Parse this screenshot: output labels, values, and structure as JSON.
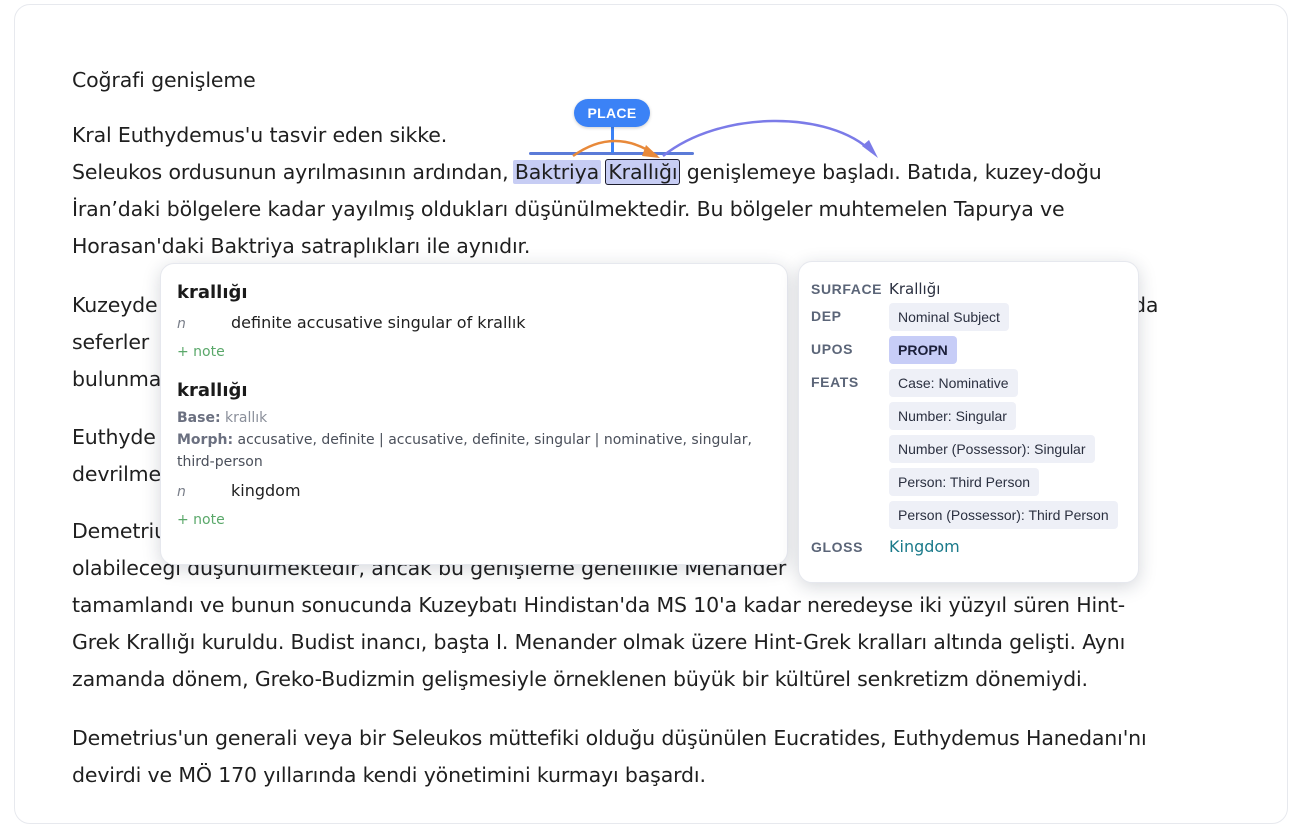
{
  "heading": "Coğrafi genişleme",
  "p1": {
    "line1": "Kral Euthydemus'u tasvir eden sikke.",
    "line2_pre": "Seleukos ordusunun ayrılmasının ardından, ",
    "span_word1": "Baktriya",
    "span_word2": "Krallığı",
    "line2_post": " genişlemeye başladı. Batıda, kuzey-doğu",
    "line3": "İran’daki bölgelere kadar yayılmış oldukları düşünülmektedir. Bu bölgeler muhtemelen Tapurya ve",
    "line4": "Horasan'daki Baktriya satraplıkları ile aynıdır."
  },
  "p2": {
    "line1_a": "Kuzeyde",
    "line1_b": "da",
    "line2": "seferler",
    "line3": "bulunma"
  },
  "p3": {
    "line1": "Euthyde",
    "line2": "devrilme"
  },
  "p4": {
    "line1": "Demetriu",
    "line2": "olabileceği düşünülmektedir, ancak bu genişleme genellikle Menander",
    "line3": "tamamlandı ve bunun sonucunda Kuzeybatı Hindistan'da MS 10'a kadar neredeyse iki yüzyıl süren Hint-",
    "line4": "Grek Krallığı kuruldu. Budist inancı, başta I. Menander olmak üzere Hint-Grek kralları altında gelişti. Aynı",
    "line5": "zamanda dönem, Greko-Budizmin gelişmesiyle örneklenen büyük bir kültürel senkretizm dönemiydi."
  },
  "p5": {
    "line1": "Demetrius'un generali veya bir Seleukos müttefiki olduğu düşünülen Eucratides, Euthydemus Hanedanı'nı",
    "line2": "devirdi ve MÖ 170 yıllarında kendi yönetimini kurmayı başardı."
  },
  "entity_tag": "PLACE",
  "dictionary": {
    "entry1": {
      "word": "krallığı",
      "pos": "n",
      "definition": "definite accusative singular of krallık",
      "note": "+ note"
    },
    "entry2": {
      "word": "krallığı",
      "base_label": "Base:",
      "base_value": "krallık",
      "morph_label": "Morph:",
      "morph_value": "accusative, definite | accusative, definite, singular | nominative, singular, third-person",
      "pos": "n",
      "definition": "kingdom",
      "note": "+ note"
    }
  },
  "linguistics": {
    "surface_label": "SURFACE",
    "surface_value": "Krallığı",
    "dep_label": "DEP",
    "dep_value": "Nominal Subject",
    "upos_label": "UPOS",
    "upos_value": "PROPN",
    "feats_label": "FEATS",
    "feats": [
      "Case: Nominative",
      "Number: Singular",
      "Number (Possessor): Singular",
      "Person: Third Person",
      "Person (Possessor): Third Person"
    ],
    "gloss_label": "GLOSS",
    "gloss_value": "Kingdom"
  },
  "colors": {
    "entity_tag": "#3b82f6",
    "highlight": "#c7cdf4",
    "arc_orange": "#e8893a",
    "arc_purple": "#7b7be8"
  }
}
